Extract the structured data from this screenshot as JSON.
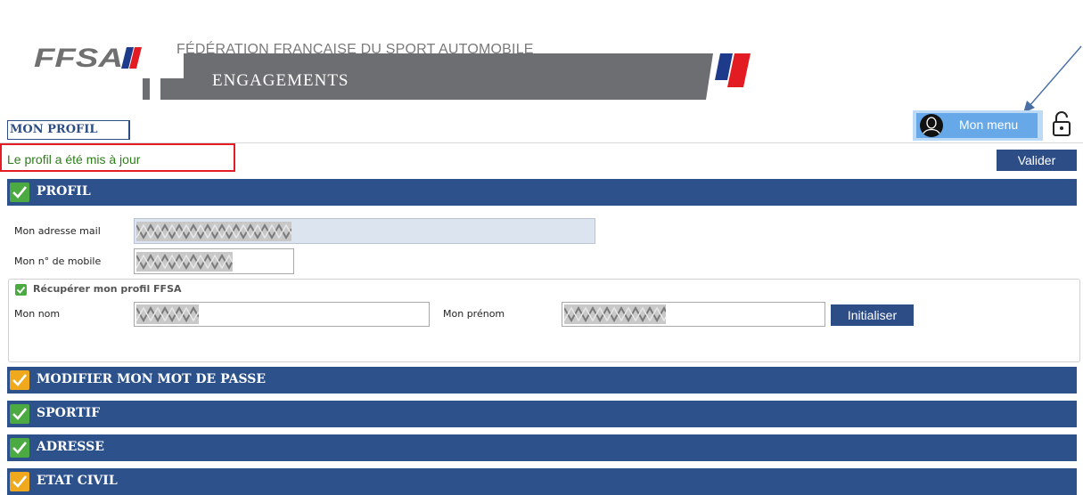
{
  "header": {
    "logo_text": "FFSA",
    "federation": "FÉDÉRATION FRANÇAISE DU SPORT AUTOMOBILE",
    "app_name": "ENGAGEMENTS"
  },
  "page_title": "MON PROFIL",
  "menu": {
    "label": "Mon menu",
    "avatar_icon": "user-silhouette-icon",
    "lock_icon": "padlock-open-icon"
  },
  "status_message": "Le profil a été mis à jour",
  "actions": {
    "valider": "Valider",
    "initialiser": "Initialiser"
  },
  "sections": [
    {
      "label": "PROFIL",
      "status": "complete",
      "color": "#4caa42"
    },
    {
      "label": "MODIFIER MON MOT DE PASSE",
      "status": "incomplete",
      "color": "#f0a91c"
    },
    {
      "label": "SPORTIF",
      "status": "complete",
      "color": "#4caa42"
    },
    {
      "label": "ADRESSE",
      "status": "complete",
      "color": "#4caa42"
    },
    {
      "label": "ETAT CIVIL",
      "status": "incomplete",
      "color": "#f0a91c"
    }
  ],
  "profil_form": {
    "email_label": "Mon adresse mail",
    "mobile_label": "Mon n° de mobile",
    "recup_label": "Récupérer mon profil FFSA",
    "recup_checked": true,
    "nom_label": "Mon nom",
    "prenom_label": "Mon prénom"
  },
  "colors": {
    "section_bar": "#2d528b",
    "button": "#2d4d86",
    "status_text": "#2e7d1b",
    "status_border": "#e51c23",
    "menu": "#66a8e8"
  }
}
